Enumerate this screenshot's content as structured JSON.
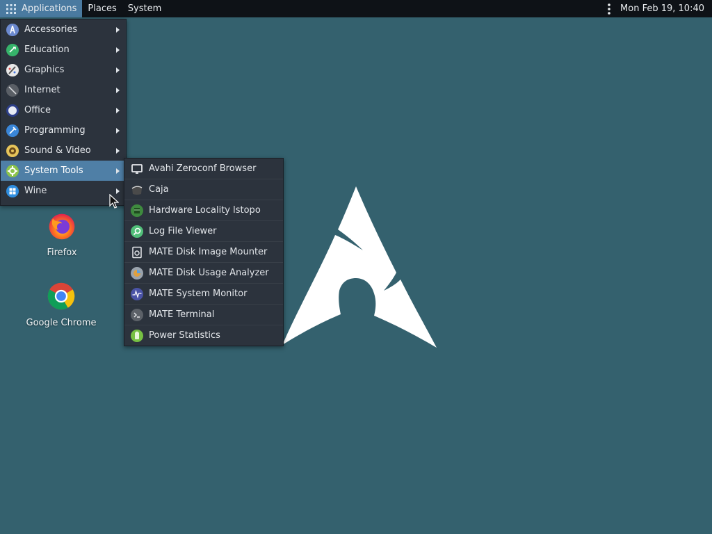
{
  "panel": {
    "applications_label": "Applications",
    "places_label": "Places",
    "system_label": "System",
    "clock": "Mon Feb 19, 10:40"
  },
  "main_menu": {
    "items": [
      {
        "label": "Accessories",
        "icon": "accessories-icon"
      },
      {
        "label": "Education",
        "icon": "education-icon"
      },
      {
        "label": "Graphics",
        "icon": "graphics-icon"
      },
      {
        "label": "Internet",
        "icon": "internet-icon"
      },
      {
        "label": "Office",
        "icon": "office-icon"
      },
      {
        "label": "Programming",
        "icon": "programming-icon"
      },
      {
        "label": "Sound & Video",
        "icon": "sound-video-icon"
      },
      {
        "label": "System Tools",
        "icon": "system-tools-icon",
        "selected": true
      },
      {
        "label": "Wine",
        "icon": "wine-icon"
      }
    ]
  },
  "system_tools_menu": {
    "items": [
      {
        "label": "Avahi Zeroconf Browser",
        "icon": "monitor-icon"
      },
      {
        "label": "Caja",
        "icon": "caja-icon"
      },
      {
        "label": "Hardware Locality lstopo",
        "icon": "hardware-icon"
      },
      {
        "label": "Log File Viewer",
        "icon": "log-viewer-icon"
      },
      {
        "label": "MATE Disk Image Mounter",
        "icon": "disk-image-icon"
      },
      {
        "label": "MATE Disk Usage Analyzer",
        "icon": "disk-usage-icon"
      },
      {
        "label": "MATE System Monitor",
        "icon": "system-monitor-icon"
      },
      {
        "label": "MATE Terminal",
        "icon": "terminal-icon"
      },
      {
        "label": "Power Statistics",
        "icon": "battery-icon"
      }
    ]
  },
  "desktop": {
    "icons": [
      {
        "label": "Firefox",
        "icon": "firefox-icon"
      },
      {
        "label": "Google Chrome",
        "icon": "chrome-icon"
      }
    ]
  },
  "colors": {
    "desktop_bg": "#34616e",
    "panel_bg": "#0e1217",
    "menu_bg": "#2c333d",
    "selection": "#4f7fa6"
  }
}
